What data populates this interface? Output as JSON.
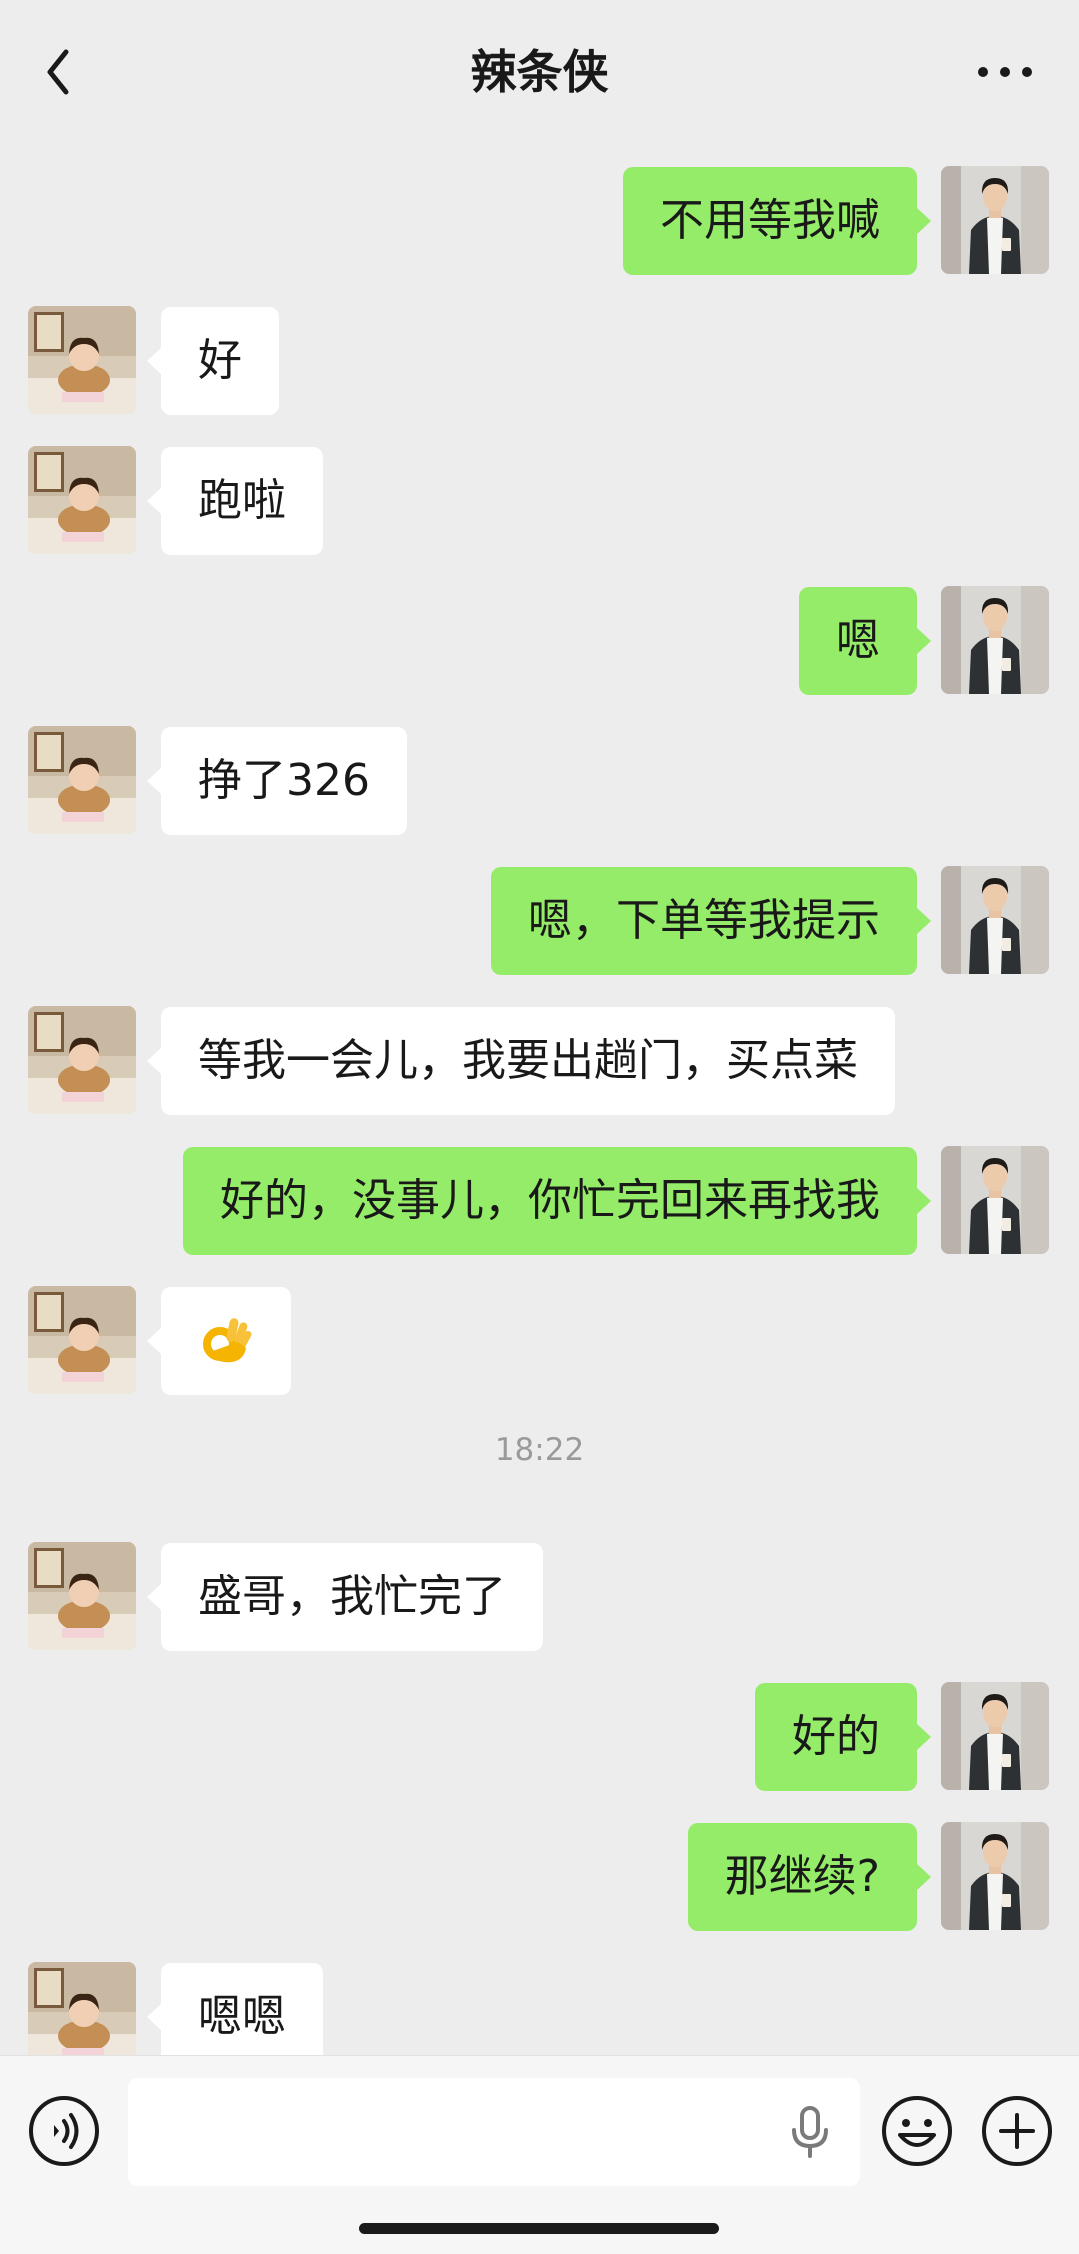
{
  "header": {
    "title": "辣条侠",
    "back_icon": "chevron-left-icon",
    "more_icon": "more-dots-icon"
  },
  "messages": [
    {
      "side": "right",
      "text": "不用等我喊"
    },
    {
      "side": "left",
      "text": "好"
    },
    {
      "side": "left",
      "text": "跑啦"
    },
    {
      "side": "right",
      "text": "嗯"
    },
    {
      "side": "left",
      "text": "挣了326"
    },
    {
      "side": "right",
      "text": "嗯，下单等我提示"
    },
    {
      "side": "left",
      "text": "等我一会儿，我要出趟门，买点菜"
    },
    {
      "side": "right",
      "text": "好的，没事儿，你忙完回来再找我"
    },
    {
      "side": "left",
      "emoji": "ok-hand-emoji"
    },
    {
      "side": "left",
      "text": "盛哥，我忙完了"
    },
    {
      "side": "right",
      "text": "好的"
    },
    {
      "side": "right",
      "text": "那继续?"
    },
    {
      "side": "left",
      "text": "嗯嗯"
    }
  ],
  "timestamp": "18:22",
  "input_bar": {
    "value": "",
    "voice_icon": "voice-mode-icon",
    "mic_icon": "microphone-icon",
    "emoji_icon": "emoji-smile-icon",
    "plus_icon": "plus-circle-icon"
  },
  "colors": {
    "background": "#ededed",
    "sent_bubble": "#95ec69",
    "received_bubble": "#ffffff",
    "timestamp_text": "#9a9a9a"
  }
}
